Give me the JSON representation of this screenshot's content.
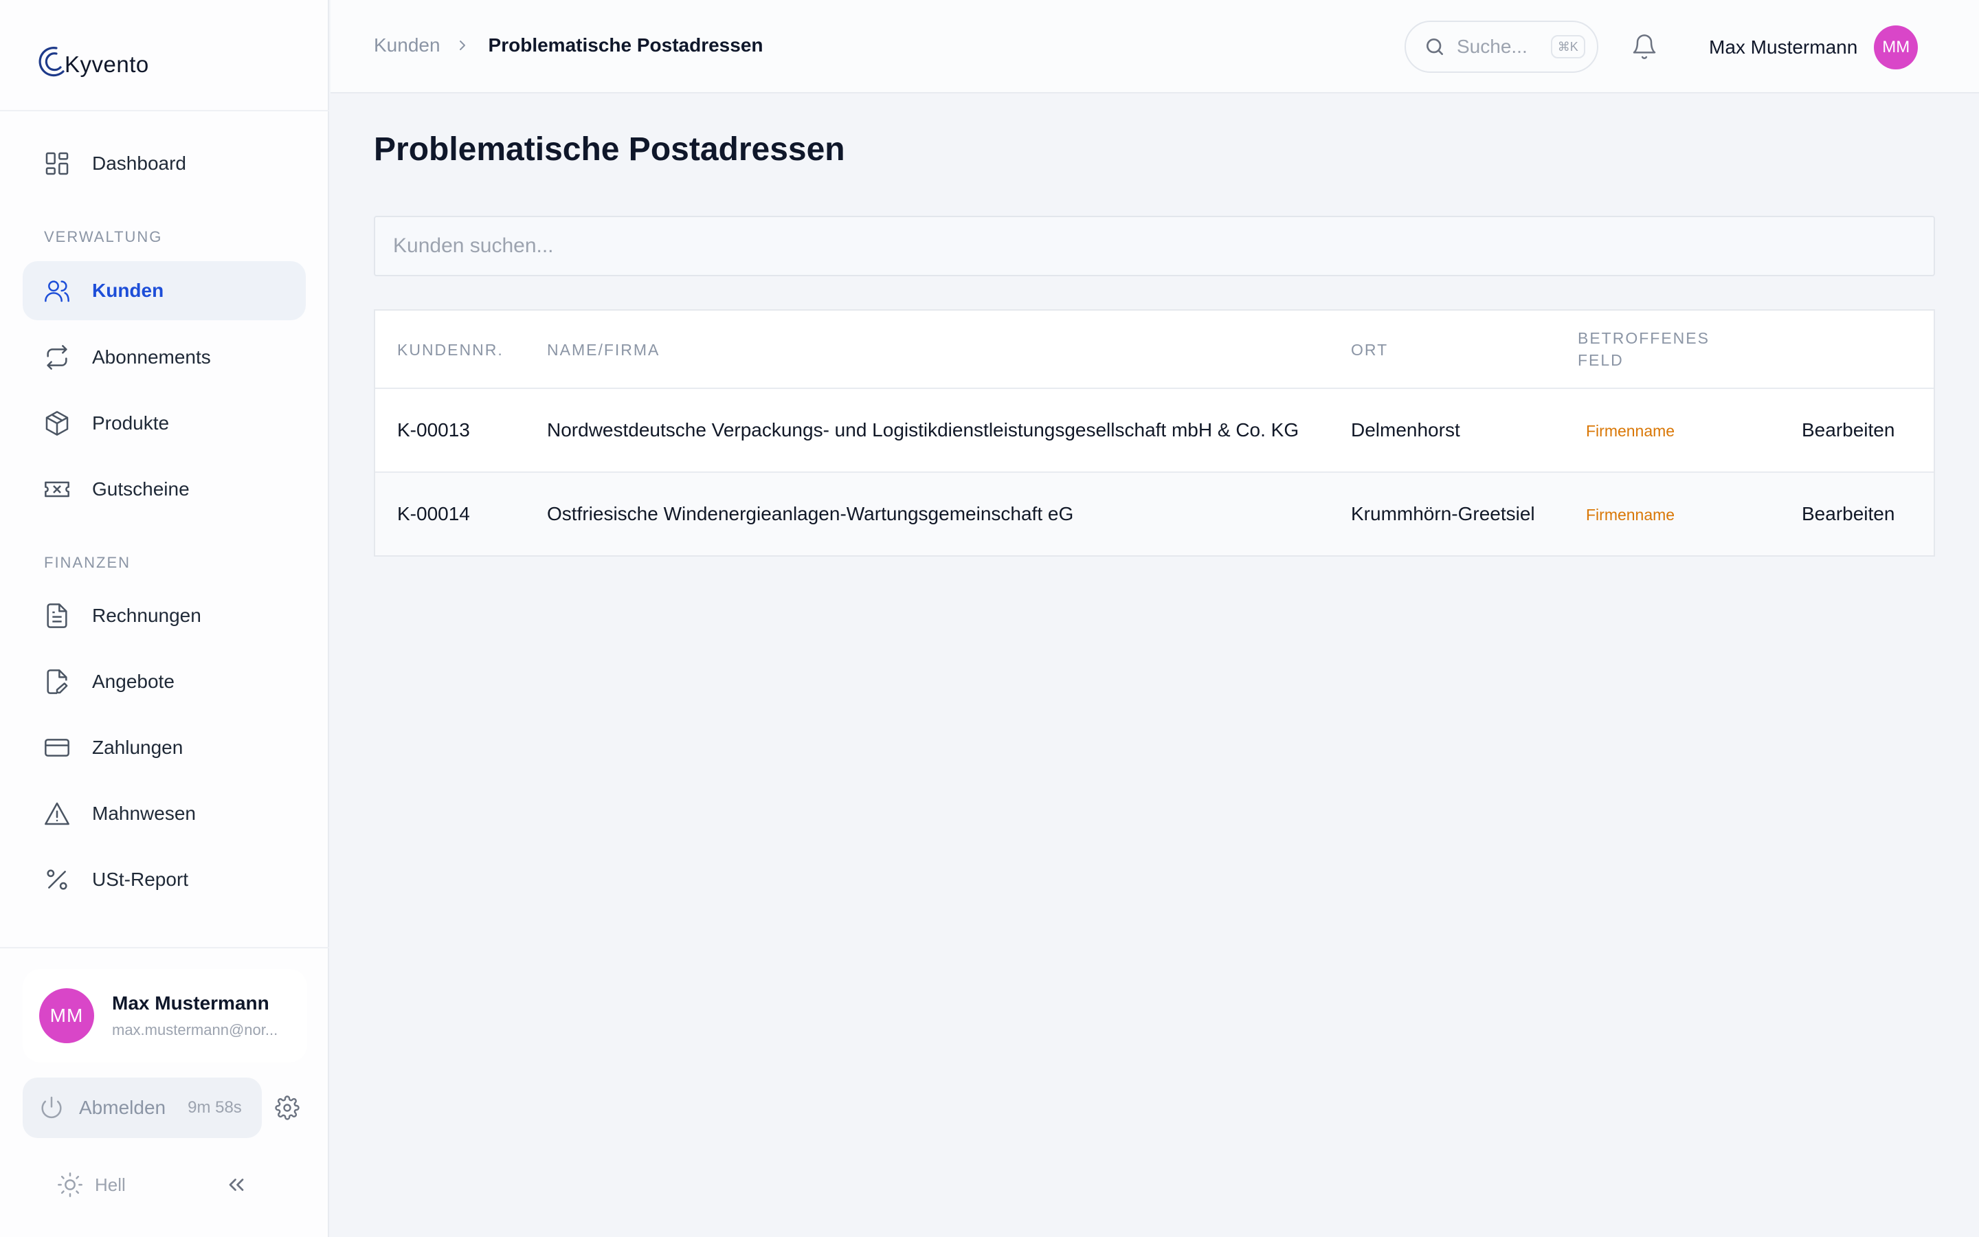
{
  "app": {
    "logo_text": "Kyvento"
  },
  "sidebar": {
    "dashboard": "Dashboard",
    "section_verwaltung": "VERWALTUNG",
    "verwaltung_items": [
      {
        "label": "Kunden",
        "icon": "users-icon",
        "active": true
      },
      {
        "label": "Abonnements",
        "icon": "repeat-icon"
      },
      {
        "label": "Produkte",
        "icon": "package-icon"
      },
      {
        "label": "Gutscheine",
        "icon": "ticket-icon"
      }
    ],
    "section_finanzen": "FINANZEN",
    "finanzen_items": [
      {
        "label": "Rechnungen",
        "icon": "file-text-icon"
      },
      {
        "label": "Angebote",
        "icon": "file-edit-icon"
      },
      {
        "label": "Zahlungen",
        "icon": "credit-card-icon"
      },
      {
        "label": "Mahnwesen",
        "icon": "warning-icon"
      },
      {
        "label": "USt-Report",
        "icon": "percent-icon"
      }
    ],
    "user": {
      "initials": "MM",
      "name": "Max Mustermann",
      "email": "max.mustermann@nor..."
    },
    "logout": {
      "label": "Abmelden",
      "timer": "9m 58s"
    },
    "theme": {
      "label": "Hell"
    }
  },
  "header": {
    "breadcrumb": {
      "parent": "Kunden",
      "current": "Problematische Postadressen"
    },
    "search": {
      "placeholder": "Suche...",
      "shortcut": "⌘K"
    },
    "user": {
      "name": "Max Mustermann",
      "initials": "MM"
    }
  },
  "main": {
    "title": "Problematische Postadressen",
    "search_placeholder": "Kunden suchen...",
    "table": {
      "headers": {
        "kundennr": "KUNDENNR.",
        "name": "NAME/FIRMA",
        "ort": "ORT",
        "feld_line1": "BETROFFENES",
        "feld_line2": "FELD"
      },
      "rows": [
        {
          "kundennr": "K-00013",
          "name": "Nordwestdeutsche Verpackungs- und Logistikdienstleistungsgesellschaft mbH & Co. KG",
          "ort": "Delmenhorst",
          "feld": "Firmenname",
          "action": "Bearbeiten"
        },
        {
          "kundennr": "K-00014",
          "name": "Ostfriesische Windenergieanlagen-Wartungsgemeinschaft eG",
          "ort": "Krummhörn-Greetsiel",
          "feld": "Firmenname",
          "action": "Bearbeiten"
        }
      ]
    }
  },
  "colors": {
    "accent": "#1d4ed8",
    "avatar": "#d946c8",
    "warning_text": "#d97706"
  }
}
